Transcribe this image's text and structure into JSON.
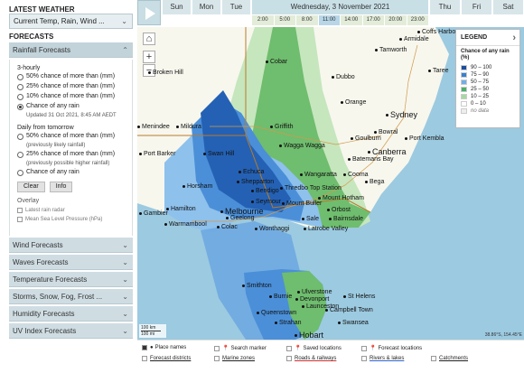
{
  "sidebar": {
    "latest_heading": "LATEST WEATHER",
    "latest_dropdown": "Current Temp, Rain, Wind ...",
    "forecasts_heading": "FORECASTS",
    "rainfall_label": "Rainfall Forecasts",
    "three_hourly": "3-hourly",
    "three_hourly_options": [
      "50% chance of more than (mm)",
      "25% chance of more than (mm)",
      "10% chance of more than (mm)",
      "Chance of any rain"
    ],
    "updated": "Updated 31 Oct 2021, 8:45 AM AEDT",
    "daily_heading": "Daily from tomorrow",
    "daily_opt1": "50% chance of more than (mm)",
    "daily_note1": "(previously likely rainfall)",
    "daily_opt2": "25% chance of more than (mm)",
    "daily_note2": "(previously possible higher rainfall)",
    "daily_opt3": "Chance of any rain",
    "clear_label": "Clear",
    "info_label": "Info",
    "overlay_heading": "Overlay",
    "overlay_1": "Latest rain radar",
    "overlay_2": "Mean Sea Level Pressure (hPa)",
    "other_forecasts": [
      "Wind Forecasts",
      "Waves Forecasts",
      "Temperature Forecasts",
      "Storms, Snow, Fog, Frost ...",
      "Humidity Forecasts",
      "UV Index Forecasts"
    ]
  },
  "timebar": {
    "days": [
      "Sun",
      "Mon",
      "Tue",
      "Wednesday, 3 November 2021",
      "Thu",
      "Fri",
      "Sat"
    ],
    "hours": [
      "2:00",
      "5:00",
      "8:00",
      "11:00",
      "14:00",
      "17:00",
      "20:00",
      "23:00"
    ]
  },
  "map": {
    "places": [
      "Coffs Harbour",
      "Armidale",
      "Tamworth",
      "Taree",
      "Dubbo",
      "Orange",
      "Sydney",
      "Bowral",
      "Port Kembla",
      "Goulburn",
      "Canberra",
      "Batemans Bay",
      "Cooma",
      "Bega",
      "Cobar",
      "Griffith",
      "Wagga Wagga",
      "Wangaratta",
      "Thredbo Top Station",
      "Mount Hotham",
      "Mount Buller",
      "Orbost",
      "Sale",
      "Bairnsdale",
      "Latrobe Valley",
      "Echuca",
      "Shepparton",
      "Bendigo",
      "Seymour",
      "Melbourne",
      "Geelong",
      "Colac",
      "Wonthaggi",
      "Horsham",
      "Hamilton",
      "Warrnambool",
      "Gambier",
      "Swan Hill",
      "Mildura",
      "Broken Hill",
      "Menindee",
      "Port Barker",
      "Smithton",
      "Burnie",
      "Devonport",
      "Ulverstone",
      "Launceston",
      "St Helens",
      "Campbell Town",
      "Queenstown",
      "Strahan",
      "Swansea",
      "Hobart"
    ],
    "legend_title": "LEGEND",
    "legend_subtitle": "Chance of any rain (%)",
    "legend_items": [
      {
        "label": "90 – 100",
        "color": "#1a4fa0"
      },
      {
        "label": "75 – 90",
        "color": "#3a7fcf"
      },
      {
        "label": "50 – 75",
        "color": "#72aee3"
      },
      {
        "label": "25 – 50",
        "color": "#4caf6a"
      },
      {
        "label": "10 – 25",
        "color": "#a6d9a0"
      },
      {
        "label": "0 – 10",
        "color": "#ffffff"
      },
      {
        "label": "no data",
        "color": "#eeeeee"
      }
    ],
    "scale_1": "100 km",
    "scale_2": "100 mi",
    "coords": "38.86°S, 154.45°E",
    "colors": {
      "ocean": "#9ccae0",
      "land": "#f7f7ee",
      "light_green": "#c6e6bd",
      "green": "#6fbd6e",
      "light_blue": "#8ec1ec",
      "blue": "#4b8fd8",
      "dark_blue": "#2461b4"
    }
  },
  "bottombar": {
    "place_names": "Place names",
    "search_marker": "Search marker",
    "saved_locations": "Saved locations",
    "forecast_locations": "Forecast locations",
    "forecast_districts": "Forecast districts",
    "marine_zones": "Marine zones",
    "roads_railways": "Roads & railways",
    "rivers_lakes": "Rivers & lakes",
    "catchments": "Catchments"
  }
}
